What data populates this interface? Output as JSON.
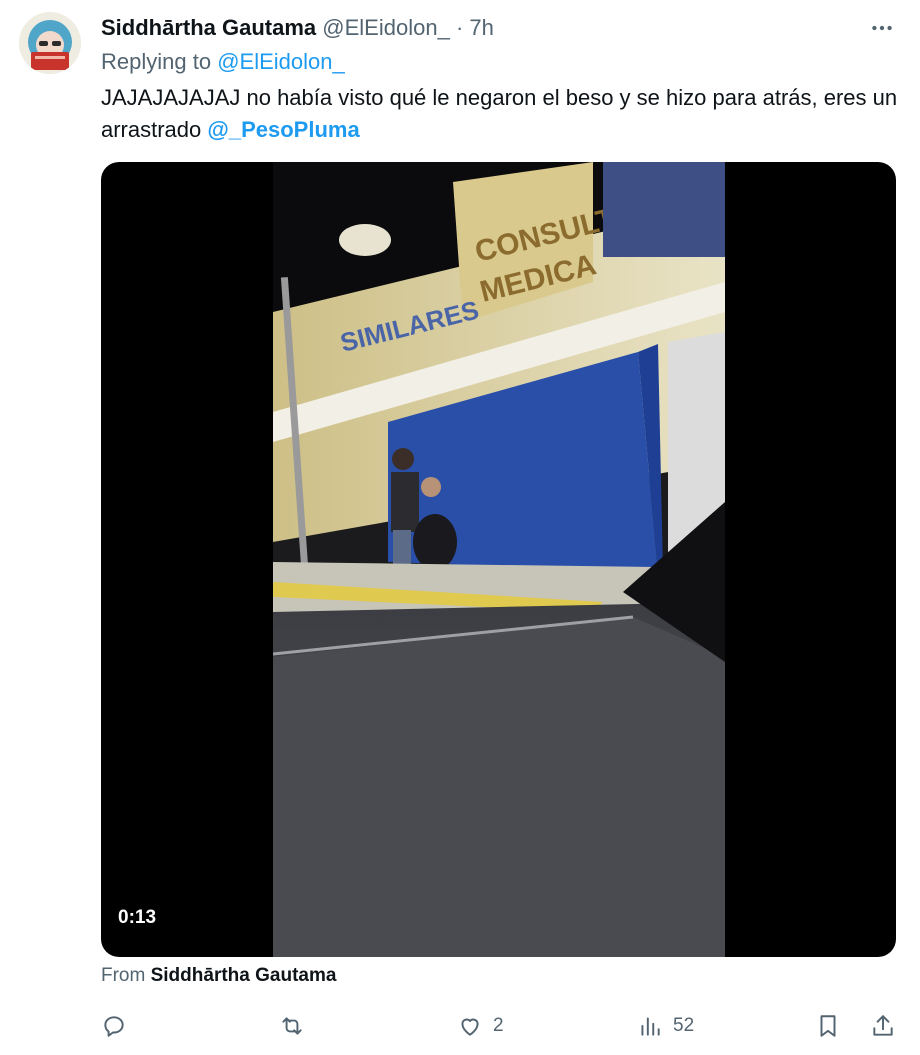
{
  "tweet": {
    "author_name": "Siddhārtha Gautama",
    "author_handle": "@ElEidolon_",
    "separator": "·",
    "time": "7h",
    "replying_prefix": "Replying to",
    "replying_handle": "@ElEidolon_",
    "text_main": "JAJAJAJAJAJ no había visto qué le negaron el beso y se hizo para atrás, eres un arrastrado",
    "text_mention": "@_PesoPluma",
    "media": {
      "duration": "0:13",
      "sign_text_1": "CONSULTA",
      "sign_text_2": "MEDICA",
      "sign_text_3": "SIMILARES"
    },
    "from_prefix": "From",
    "from_name": "Siddhārtha Gautama"
  },
  "actions": {
    "reply_count": "",
    "retweet_count": "",
    "like_count": "2",
    "views_count": "52"
  },
  "icons": [
    "more-icon",
    "reply-icon",
    "retweet-icon",
    "like-icon",
    "views-icon",
    "bookmark-icon",
    "share-icon"
  ],
  "colors": {
    "accent": "#1d9bf0",
    "secondary_text": "#536471",
    "primary_text": "#0f1419"
  }
}
